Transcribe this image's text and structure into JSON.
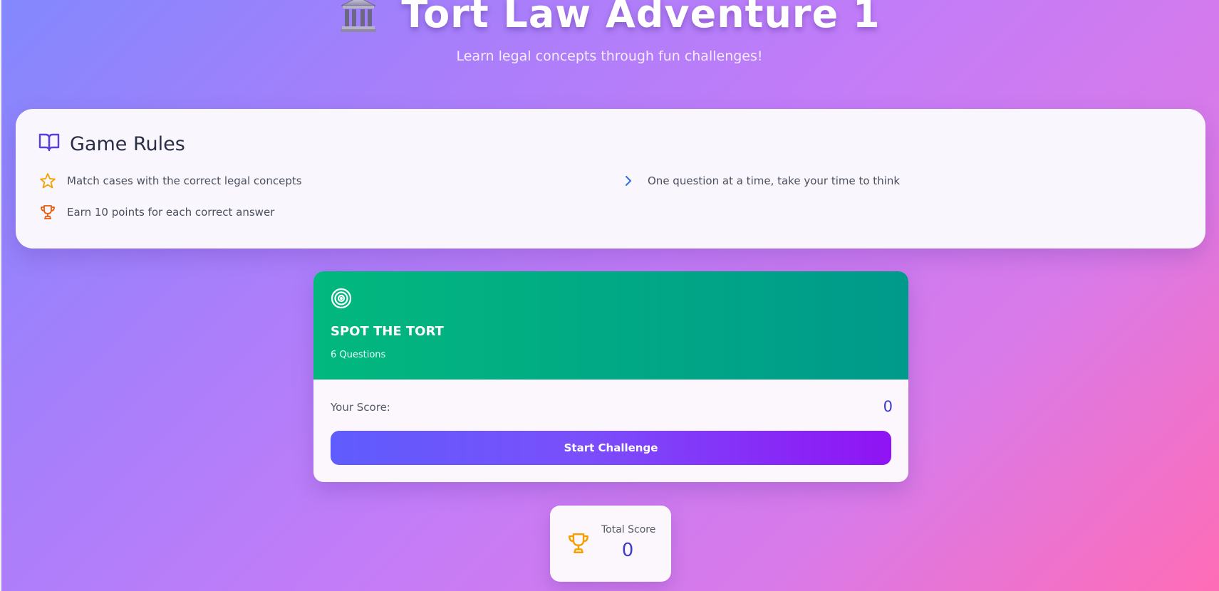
{
  "header": {
    "title_icon": "classical-building-emoji",
    "title": "Tort Law Adventure 1",
    "subtitle": "Learn legal concepts through fun challenges!"
  },
  "rules": {
    "title": "Game Rules",
    "title_icon": "open-book-icon",
    "items": [
      {
        "icon": "star-icon",
        "text": "Match cases with the correct legal concepts",
        "color": "#f5a000"
      },
      {
        "icon": "trophy-icon",
        "text": "Earn 10 points for each correct answer",
        "color": "#ea5a0c"
      },
      {
        "icon": "chevron-right-icon",
        "text": "One question at a time, take your time to think",
        "color": "#2f6fe0"
      }
    ]
  },
  "challenge": {
    "icon": "target-icon",
    "title": "SPOT THE TORT",
    "count": "6 Questions",
    "score_label": "Your Score:",
    "score_value": "0",
    "start_label": "Start Challenge"
  },
  "total": {
    "icon": "trophy-icon",
    "label": "Total Score",
    "value": "0"
  },
  "colors": {
    "accent": "#3d3ad6",
    "challenge_green_start": "#02b87e",
    "challenge_green_end": "#009a8b",
    "button_start": "#5f5cfd",
    "button_end": "#9013f4",
    "trophy_gold": "#f5a000"
  }
}
